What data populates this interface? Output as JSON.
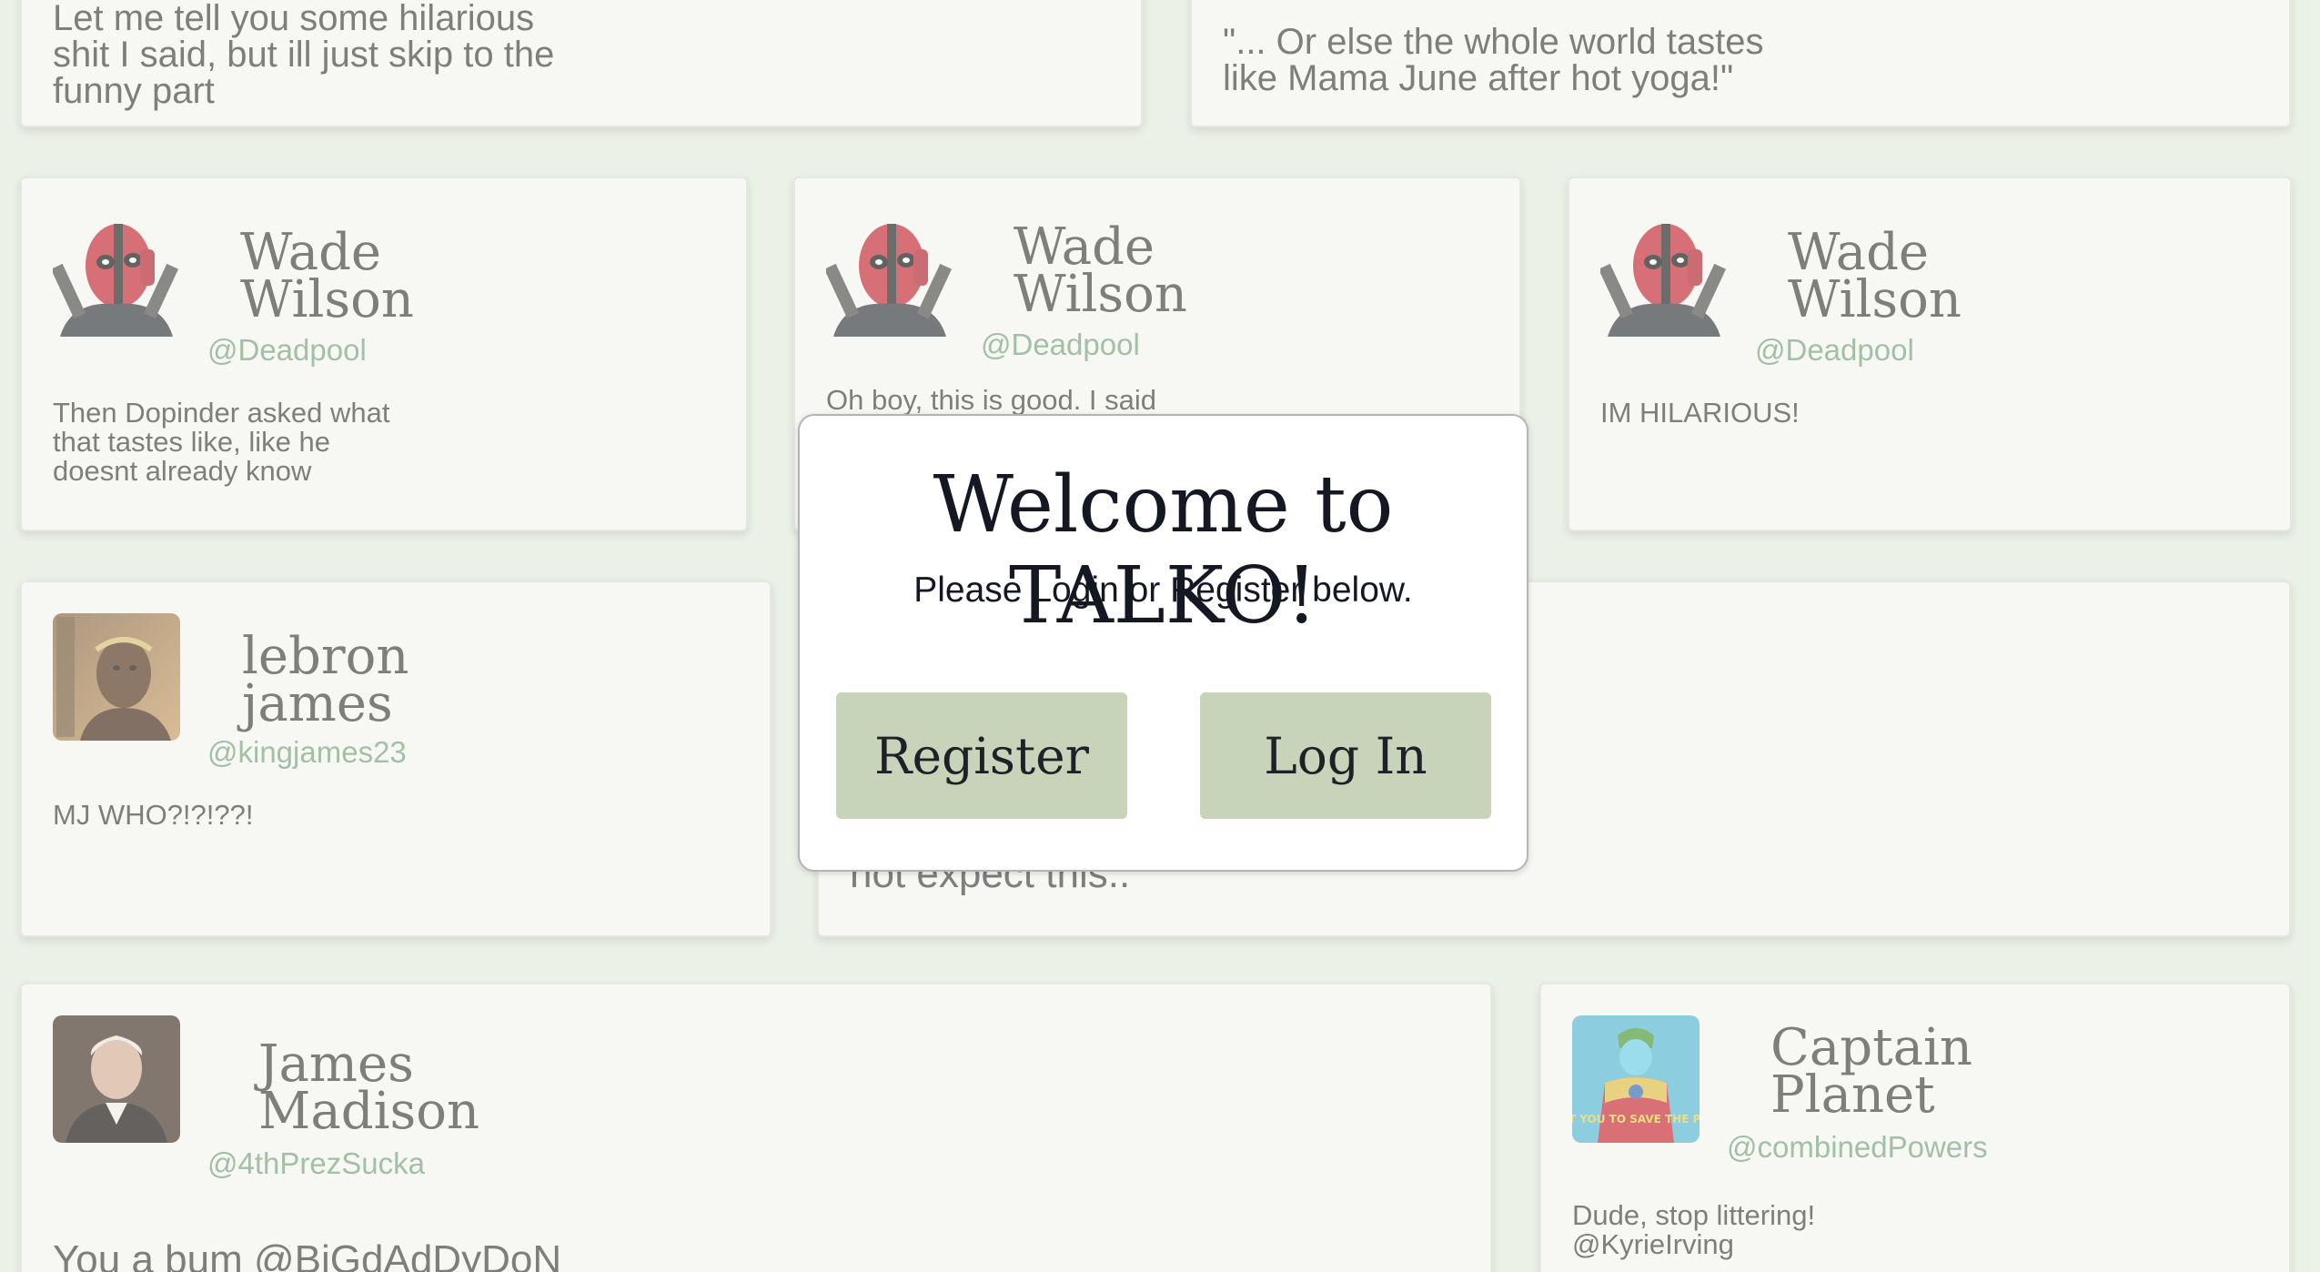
{
  "posts": [
    {
      "body": "Let me tell you some hilarious\nshit I said, but ill just skip to the\nfunny part"
    },
    {
      "body": "\"... Or else the whole world tastes\nlike Mama June after hot yoga!\""
    },
    {
      "name": "Wade\nWilson",
      "handle": "@Deadpool",
      "body": "Then Dopinder asked what\nthat tastes like, like he\ndoesnt already know",
      "avatar_icon": "deadpool-avatar"
    },
    {
      "name": "Wade\nWilson",
      "handle": "@Deadpool",
      "body": "Oh boy, this is good. I said",
      "avatar_icon": "deadpool-avatar"
    },
    {
      "name": "Wade\nWilson",
      "handle": "@Deadpool",
      "body": "IM HILARIOUS!",
      "avatar_icon": "deadpool-avatar"
    },
    {
      "name": "lebron\njames",
      "handle": "@kingjames23",
      "body": "MJ WHO?!?!??!",
      "avatar_icon": "lebron-avatar"
    },
    {
      "body": "not expect this.."
    },
    {
      "name": "James\nMadison",
      "handle": "@4thPrezSucka",
      "body": "You a bum @BiGdAdDyDoN",
      "avatar_icon": "madison-portrait-avatar"
    },
    {
      "name": "Captain\nPlanet",
      "handle": "@combinedPowers",
      "body": "Dude, stop littering!\n@KyrieIrving",
      "avatar_icon": "captain-planet-avatar",
      "avatar_caption": "I WANT YOU TO SAVE THE PLANET"
    }
  ],
  "modal": {
    "title": "Welcome to TALKO!",
    "subtitle": "Please Login or Register below.",
    "register_label": "Register",
    "login_label": "Log In"
  },
  "colors": {
    "background": "#e5eedf",
    "card": "#f7f8f3",
    "handle": "#7ba47f",
    "button": "#c8d4b9"
  }
}
